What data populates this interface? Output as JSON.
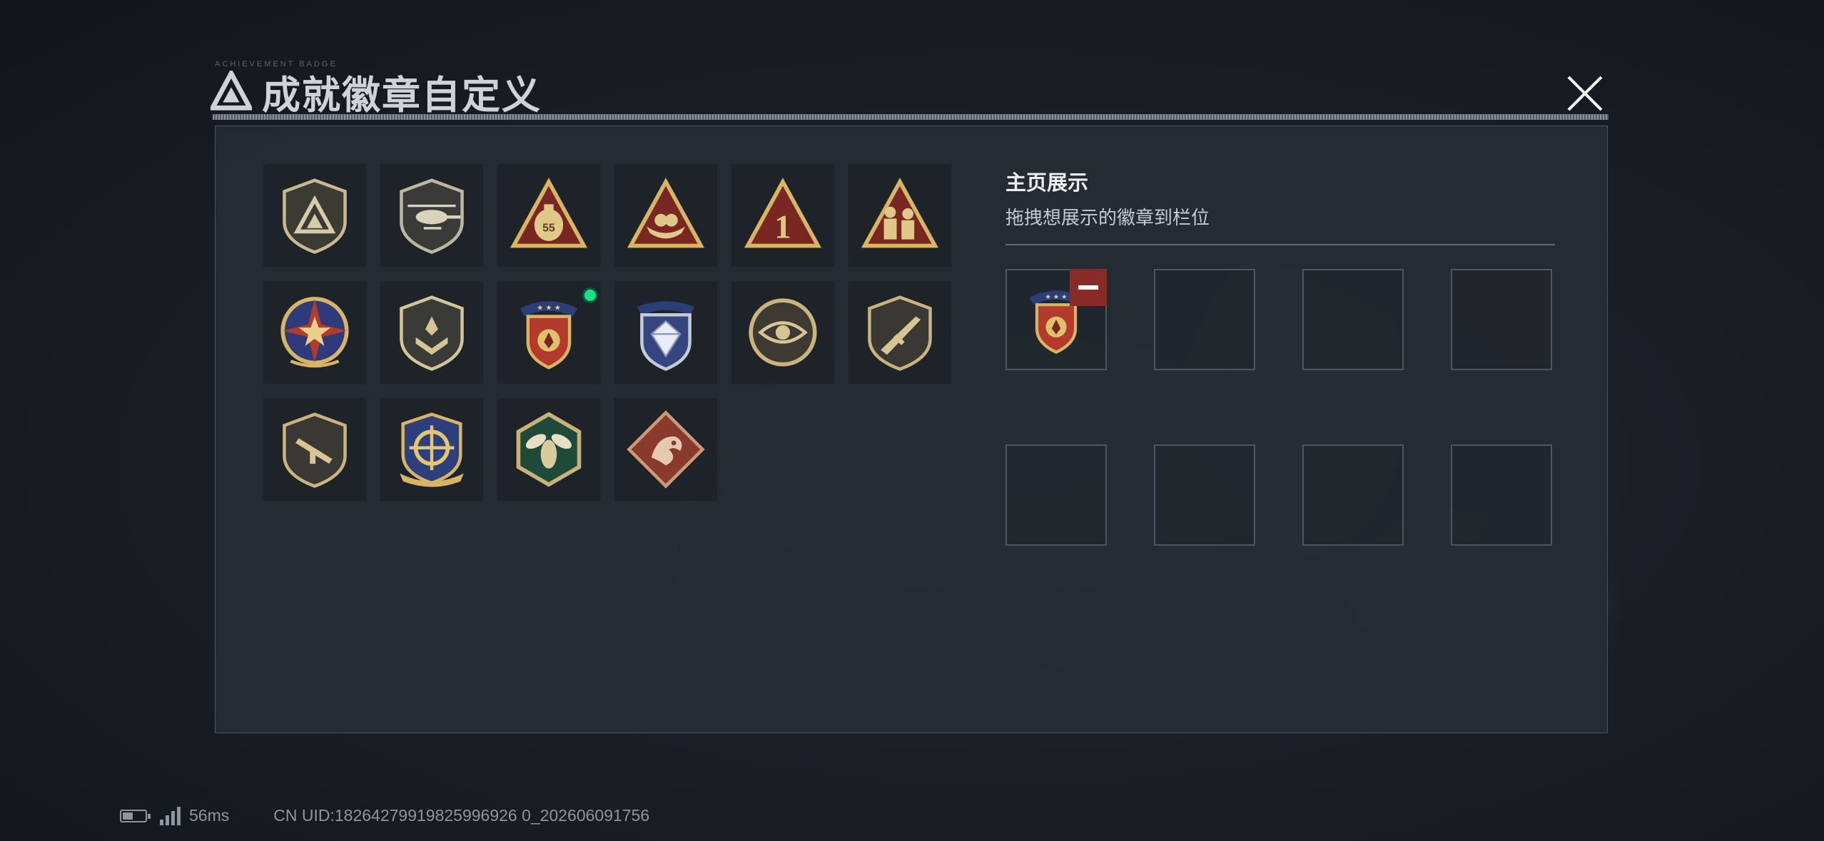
{
  "header": {
    "title": "成就徽章自定义",
    "tiny_text": "ACHIEVEMENT BADGE",
    "close_icon": "close-icon"
  },
  "colors": {
    "accent_red": "#8a2a26",
    "new_dot": "#18e08a",
    "badge_gold": "#c9a55a"
  },
  "badges": [
    {
      "icon": "triangle-shield-badge-icon"
    },
    {
      "icon": "helicopter-shield-badge-icon"
    },
    {
      "icon": "sandbag-55-triangle-badge-icon"
    },
    {
      "icon": "boat-triangle-badge-icon"
    },
    {
      "icon": "number-1-triangle-badge-icon"
    },
    {
      "icon": "soldiers-triangle-badge-icon"
    },
    {
      "icon": "star-wheel-badge-icon"
    },
    {
      "icon": "chevron-shield-badge-icon"
    },
    {
      "icon": "star-ribbon-shield-badge-icon",
      "is_new": true
    },
    {
      "icon": "diamond-crest-badge-icon"
    },
    {
      "icon": "eye-circle-badge-icon"
    },
    {
      "icon": "rifle-shield-badge-icon"
    },
    {
      "icon": "smg-shield-badge-icon"
    },
    {
      "icon": "crosshair-wreath-badge-icon"
    },
    {
      "icon": "wasp-hexagon-badge-icon"
    },
    {
      "icon": "dragon-diamond-badge-icon"
    }
  ],
  "showcase": {
    "title": "主页展示",
    "subtitle": "拖拽想展示的徽章到栏位",
    "slots": [
      {
        "badge": "star-ribbon-shield-badge-icon",
        "filled": true
      },
      {
        "filled": false
      },
      {
        "filled": false
      },
      {
        "filled": false
      },
      {
        "filled": false
      },
      {
        "filled": false
      },
      {
        "filled": false
      },
      {
        "filled": false
      }
    ]
  },
  "status_bar": {
    "ping": "56ms",
    "uid": "CN UID:18264279919825996926 0_202606091756"
  }
}
